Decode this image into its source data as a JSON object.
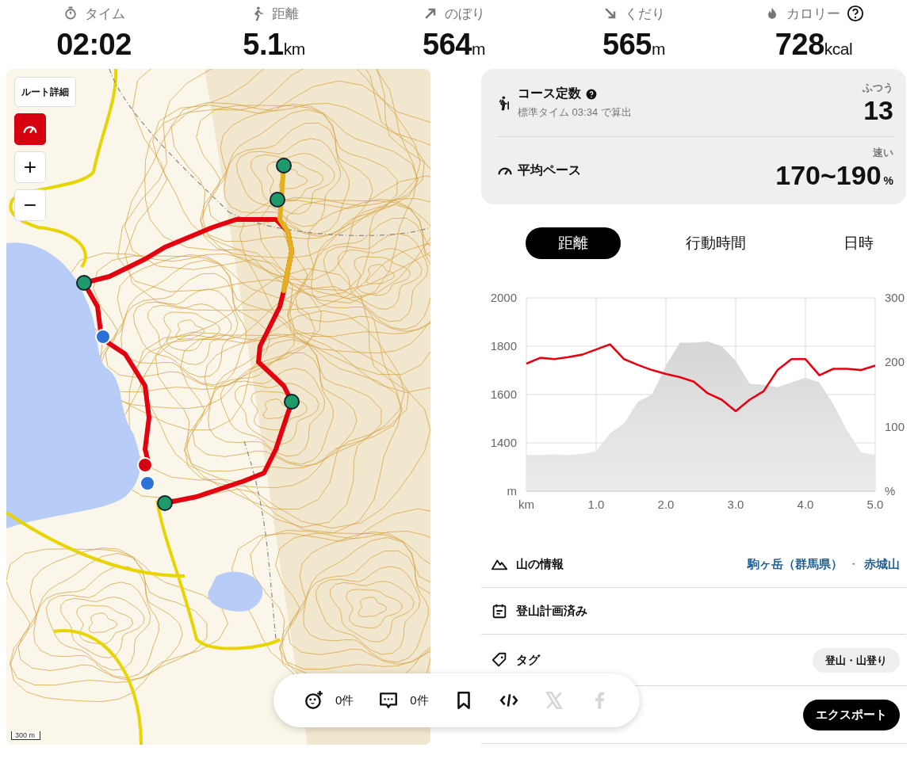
{
  "stats": [
    {
      "kind": "time",
      "label": "タイム",
      "value": "02:02"
    },
    {
      "kind": "distance",
      "label": "距離",
      "value": "5.1",
      "unit": "km"
    },
    {
      "kind": "ascent",
      "label": "のぼり",
      "value": "564",
      "unit": "m"
    },
    {
      "kind": "descent",
      "label": "くだり",
      "value": "565",
      "unit": "m"
    },
    {
      "kind": "calories",
      "label": "カロリー",
      "value": "728",
      "unit": "kcal",
      "help": true
    }
  ],
  "map": {
    "kind": "picture",
    "details_button": "ルート詳細",
    "pace_colors_on": true,
    "zoom_in": "+",
    "zoom_out": "−",
    "scale": "300 m"
  },
  "course_card": {
    "course_constant": {
      "title": "コース定数",
      "note": "標準タイム 03:34 で算出",
      "grade": "ふつう",
      "value": "13"
    },
    "average_pace": {
      "title": "平均ペース",
      "grade": "速い",
      "value": "170~190",
      "unit": "%"
    }
  },
  "chart_tabs": [
    {
      "label": "距離",
      "selected": true
    },
    {
      "label": "行動時間",
      "selected": false
    },
    {
      "label": "日時",
      "selected": false
    }
  ],
  "elevation_chart": {
    "chart_data": {
      "type": "area",
      "x": [
        0,
        0.2,
        0.4,
        0.6,
        0.8,
        1.0,
        1.2,
        1.4,
        1.6,
        1.8,
        2.0,
        2.2,
        2.4,
        2.6,
        2.8,
        3.0,
        3.2,
        3.4,
        3.6,
        3.8,
        4.0,
        4.2,
        4.4,
        4.6,
        4.8,
        5.0
      ],
      "series": [
        {
          "color": "#d6d6d6",
          "values": [
            1350,
            1350,
            1352,
            1350,
            1355,
            1365,
            1440,
            1480,
            1570,
            1600,
            1720,
            1815,
            1815,
            1820,
            1800,
            1740,
            1645,
            1640,
            1630,
            1650,
            1670,
            1650,
            1560,
            1450,
            1360,
            1350
          ]
        }
      ],
      "xlim": [
        0,
        5
      ],
      "ylim": [
        1200,
        2000
      ],
      "grid": true,
      "xticks": [
        {
          "value": 0,
          "label": "km"
        },
        {
          "value": 1,
          "label": "1.0"
        },
        {
          "value": 2,
          "label": "2.0"
        },
        {
          "value": 3,
          "label": "3.0"
        },
        {
          "value": 4,
          "label": "4.0"
        },
        {
          "value": 5,
          "label": "5.0"
        }
      ],
      "yticks": [
        {
          "value": 1200,
          "label": "m"
        },
        1400,
        1600,
        1800,
        2000
      ]
    }
  },
  "pace_chart": {
    "chart_data": {
      "type": "line",
      "categories": [
        null,
        null,
        null,
        null,
        null,
        null,
        null,
        null,
        null,
        null,
        null,
        null,
        null,
        null,
        null,
        null,
        null,
        null,
        null,
        null,
        null,
        null,
        null,
        null,
        null,
        null
      ],
      "series": [
        {
          "color": "#e60012",
          "values": [
            198,
            207,
            205,
            208,
            212,
            220,
            228,
            205,
            196,
            188,
            182,
            177,
            170,
            152,
            142,
            124,
            142,
            155,
            188,
            205,
            205,
            180,
            190,
            190,
            188,
            195
          ]
        }
      ],
      "ylim": [
        0,
        300
      ],
      "yticks": [
        {
          "value": 0,
          "label": "%"
        },
        100,
        200,
        300
      ]
    }
  },
  "info_rows": [
    {
      "kind": "mountain",
      "label": "山の情報",
      "links": [
        "駒ヶ岳（群馬県）",
        "赤城山"
      ],
      "separator": "・"
    },
    {
      "kind": "plan",
      "label": "登山計画済み"
    },
    {
      "kind": "tags",
      "label": "タグ",
      "tags": [
        "登山・山登り"
      ]
    },
    {
      "kind": "export",
      "button": "エクスポート"
    }
  ],
  "action_bar": [
    {
      "kind": "reaction",
      "count": "0件",
      "disabled": false
    },
    {
      "kind": "comment",
      "count": "0件",
      "disabled": false
    },
    {
      "kind": "bookmark",
      "disabled": false
    },
    {
      "kind": "embed",
      "disabled": false
    },
    {
      "kind": "x",
      "disabled": true
    },
    {
      "kind": "facebook",
      "disabled": true
    }
  ]
}
